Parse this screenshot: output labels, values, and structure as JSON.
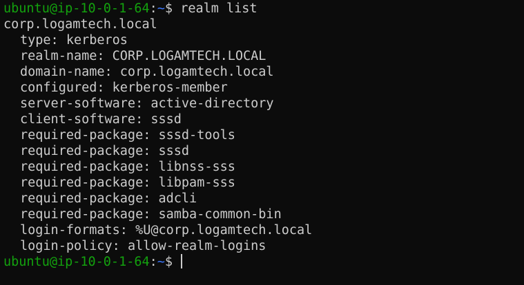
{
  "terminal": {
    "colors": {
      "background": "#0c0c0c",
      "text": "#cccccc",
      "prompt_user": "#13a10e",
      "prompt_path": "#3b78ff"
    },
    "prompt": {
      "user_host": "ubuntu@ip-10-0-1-64",
      "separator": ":",
      "path": "~",
      "symbol": "$ "
    },
    "command": "realm list",
    "realm": "corp.logamtech.local",
    "properties": [
      {
        "key": "type:",
        "value": "kerberos"
      },
      {
        "key": "realm-name:",
        "value": "CORP.LOGAMTECH.LOCAL"
      },
      {
        "key": "domain-name:",
        "value": "corp.logamtech.local"
      },
      {
        "key": "configured:",
        "value": "kerberos-member"
      },
      {
        "key": "server-software:",
        "value": "active-directory"
      },
      {
        "key": "client-software:",
        "value": "sssd"
      },
      {
        "key": "required-package:",
        "value": "sssd-tools"
      },
      {
        "key": "required-package:",
        "value": "sssd"
      },
      {
        "key": "required-package:",
        "value": "libnss-sss"
      },
      {
        "key": "required-package:",
        "value": "libpam-sss"
      },
      {
        "key": "required-package:",
        "value": "adcli"
      },
      {
        "key": "required-package:",
        "value": "samba-common-bin"
      },
      {
        "key": "login-formats:",
        "value": "%U@corp.logamtech.local"
      },
      {
        "key": "login-policy:",
        "value": "allow-realm-logins"
      }
    ]
  }
}
